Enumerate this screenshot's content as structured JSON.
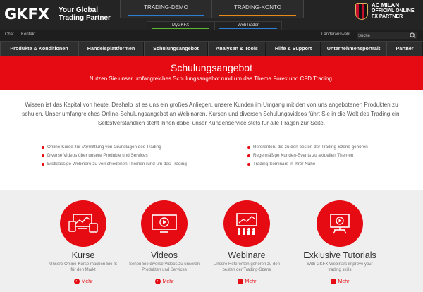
{
  "header": {
    "logo": "GKFX",
    "tagline_line1": "Your Global",
    "tagline_line2": "Trading Partner",
    "tabs": [
      {
        "label": "TRADING-DEMO",
        "accent": "#2a7fd4"
      },
      {
        "label": "TRADING-KONTO",
        "accent": "#e68a1a"
      }
    ],
    "subtabs": [
      {
        "label": "MyGKFX",
        "accent": "#5bb531"
      },
      {
        "label": "WebTrader",
        "accent": "#2a7fd4"
      }
    ],
    "partner_line1": "AC MILAN",
    "partner_line2": "OFFICIAL ONLINE",
    "partner_line3": "FX PARTNER"
  },
  "utility": {
    "chat": "Chat",
    "kontakt": "Kontakt",
    "country": "Länderauswahl",
    "search_placeholder": "Suche"
  },
  "nav": [
    "Produkte & Konditionen",
    "Handelsplattformen",
    "Schulungsangebot",
    "Analysen & Tools",
    "Hilfe & Support",
    "Unternehmensportrait",
    "Partner"
  ],
  "hero": {
    "title": "Schulungsangebot",
    "subtitle": "Nutzen Sie unser umfangreiches Schulungsangebot rund um das Thema Forex und CFD Trading."
  },
  "intro": [
    "Wissen ist das Kapital von heute. Deshalb ist es uns ein großes Anliegen, unsere Kunden im Umgang mit den von uns angebotenen Produkten zu",
    "schulen. Unser umfangreiches Online-Schulungsangebot an Webinaren, Kursen und diversen Schulungsvideos führt Sie in die Welt des Trading ein.",
    "Selbstverständlich steht Ihnen dabei unser Kundenservice stets für alle Fragen zur Seite."
  ],
  "bullets_left": [
    "Online-Kurse zur Vermittlung von Grundlagen des Trading",
    "Diverse Videos über unsere Produkte und Services",
    "Erstklassige Webinare zu verschiedenen Themen rund um das Trading"
  ],
  "bullets_right": [
    "Referenten, die zu den besten der Trading-Szene gehören",
    "Regelmäßige Kunden-Events zu aktuellen Themen",
    "Trading-Seminare in Ihrer Nähe"
  ],
  "cards": [
    {
      "title": "Kurse",
      "desc1": "Unsere Online-Kurse machen Sie fit",
      "desc2": "für den Markt",
      "more": "Mehr",
      "icon": "devices-icon"
    },
    {
      "title": "Videos",
      "desc1": "Sehen Sie diverse Videos zu unseren",
      "desc2": "Produkten und Services",
      "more": "Mehr",
      "icon": "video-play-icon"
    },
    {
      "title": "Webinare",
      "desc1": "Unsere Referenten gehören zu den",
      "desc2": "besten der Trading-Szene",
      "more": "Mehr",
      "icon": "presentation-icon"
    },
    {
      "title": "Exklusive Tutorials",
      "desc1": "With GKFX Webinars improve your",
      "desc2": "trading skills",
      "more": "Mehr",
      "icon": "tutorial-icon"
    }
  ],
  "colors": {
    "brand_red": "#e60a12",
    "header_dark": "#242424",
    "nav_dark": "#2e2e2e",
    "card_bg": "#efefef"
  }
}
